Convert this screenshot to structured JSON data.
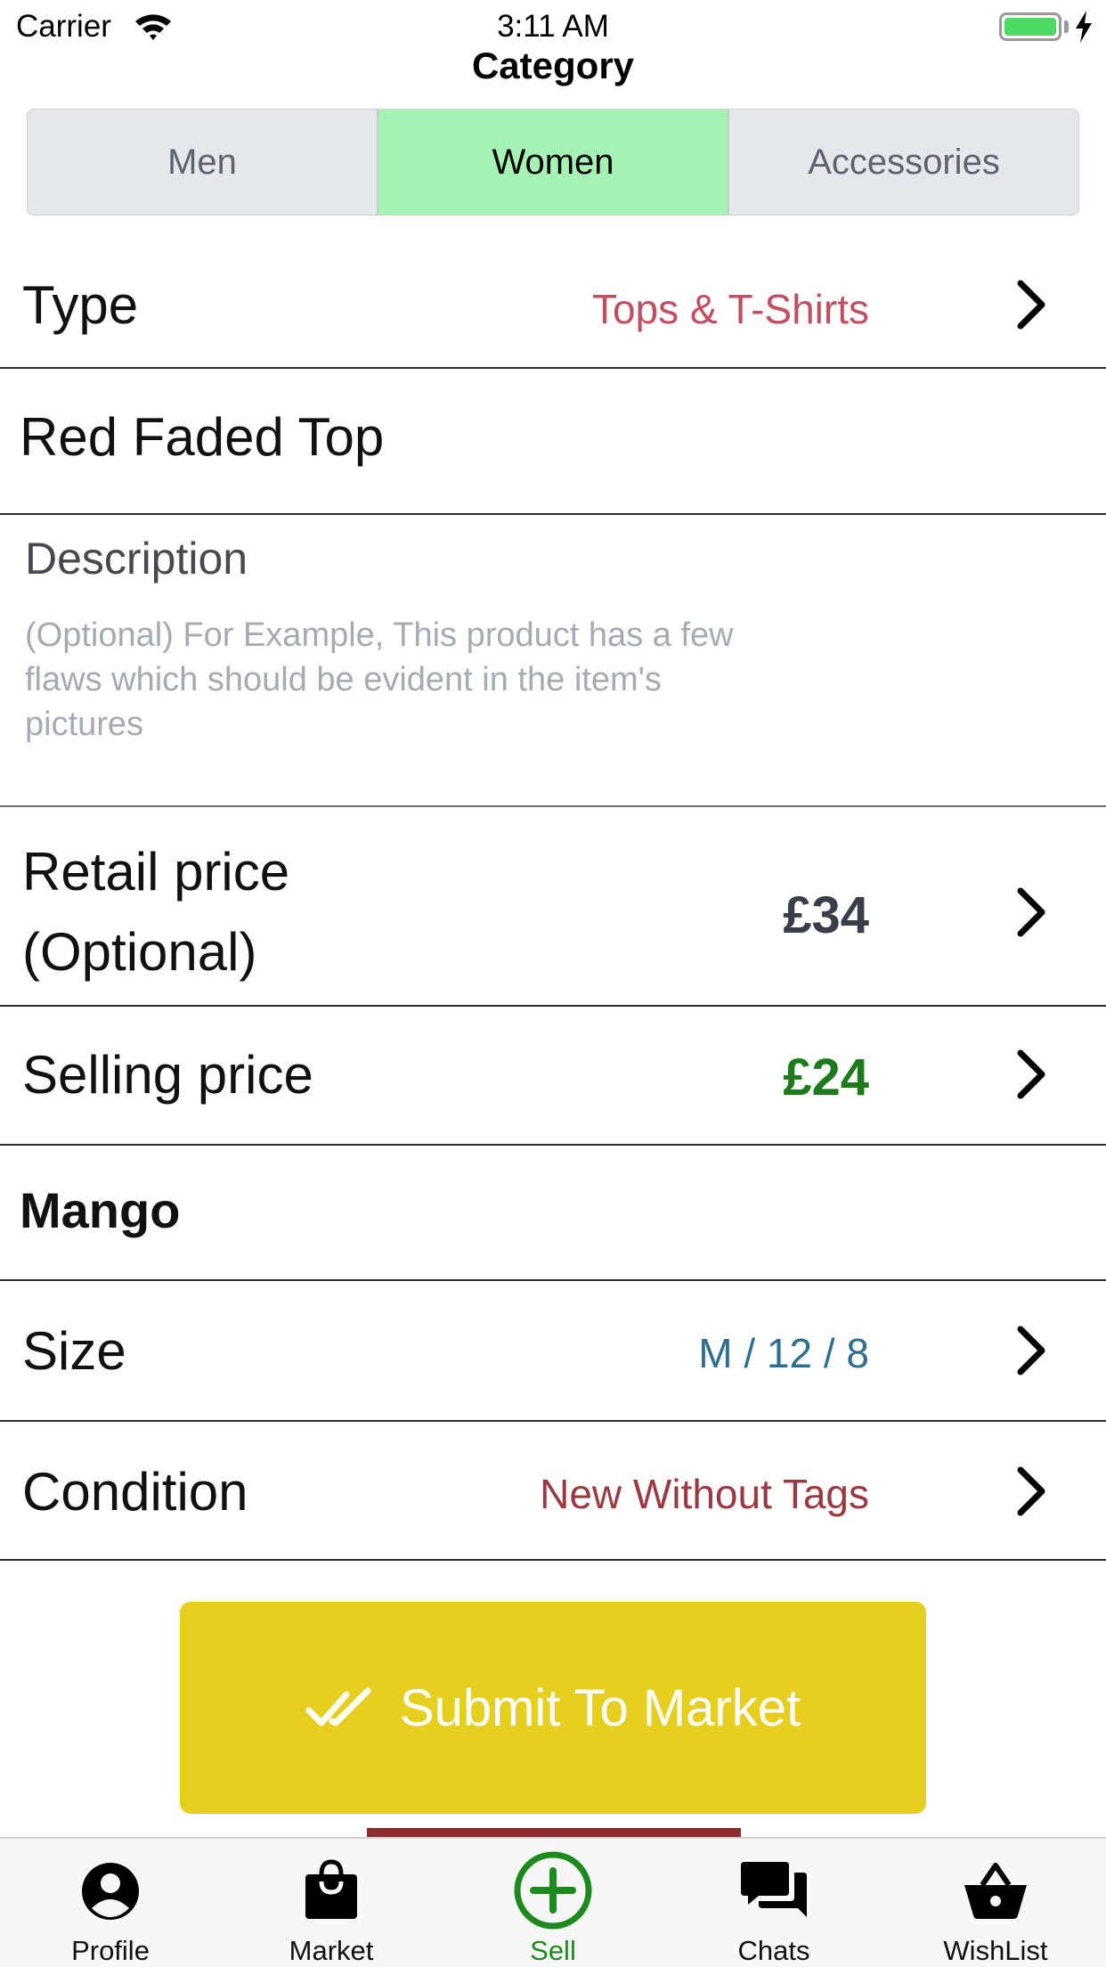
{
  "status_bar": {
    "carrier": "Carrier",
    "time": "3:11 AM",
    "battery": "charging"
  },
  "nav": {
    "title": "Category"
  },
  "segments": [
    {
      "label": "Men",
      "selected": false
    },
    {
      "label": "Women",
      "selected": true
    },
    {
      "label": "Accessories",
      "selected": false
    }
  ],
  "form": {
    "type": {
      "label": "Type",
      "value": "Tops & T-Shirts"
    },
    "title_value": "Red Faded Top",
    "description": {
      "label": "Description",
      "placeholder": "(Optional) For Example, This product has a few flaws which should be evident in the item's pictures"
    },
    "retail_price": {
      "label_line1": "Retail price",
      "label_line2": "(Optional)",
      "value": "£34"
    },
    "selling_price": {
      "label": "Selling price",
      "value": "£24"
    },
    "brand_value": "Mango",
    "size": {
      "label": "Size",
      "value": "M / 12 / 8"
    },
    "condition": {
      "label": "Condition",
      "value": "New Without Tags"
    }
  },
  "submit": {
    "label": "Submit To Market",
    "icon": "double-check-icon"
  },
  "tabs": [
    {
      "label": "Profile",
      "icon": "user-circle-icon",
      "active": false
    },
    {
      "label": "Market",
      "icon": "shopping-bag-icon",
      "active": false
    },
    {
      "label": "Sell",
      "icon": "plus-circle-icon",
      "active": true
    },
    {
      "label": "Chats",
      "icon": "chat-bubbles-icon",
      "active": false
    },
    {
      "label": "WishList",
      "icon": "basket-icon",
      "active": false
    }
  ],
  "colors": {
    "segment_selected": "#a5f2b5",
    "type_value": "#c05060",
    "retail_value": "#3a3e48",
    "selling_value": "#1d7a1d",
    "size_value": "#2e6f8e",
    "condition_value": "#9a3a40",
    "submit_background": "#e6cf1f",
    "active_tab": "#1d8a1d"
  }
}
